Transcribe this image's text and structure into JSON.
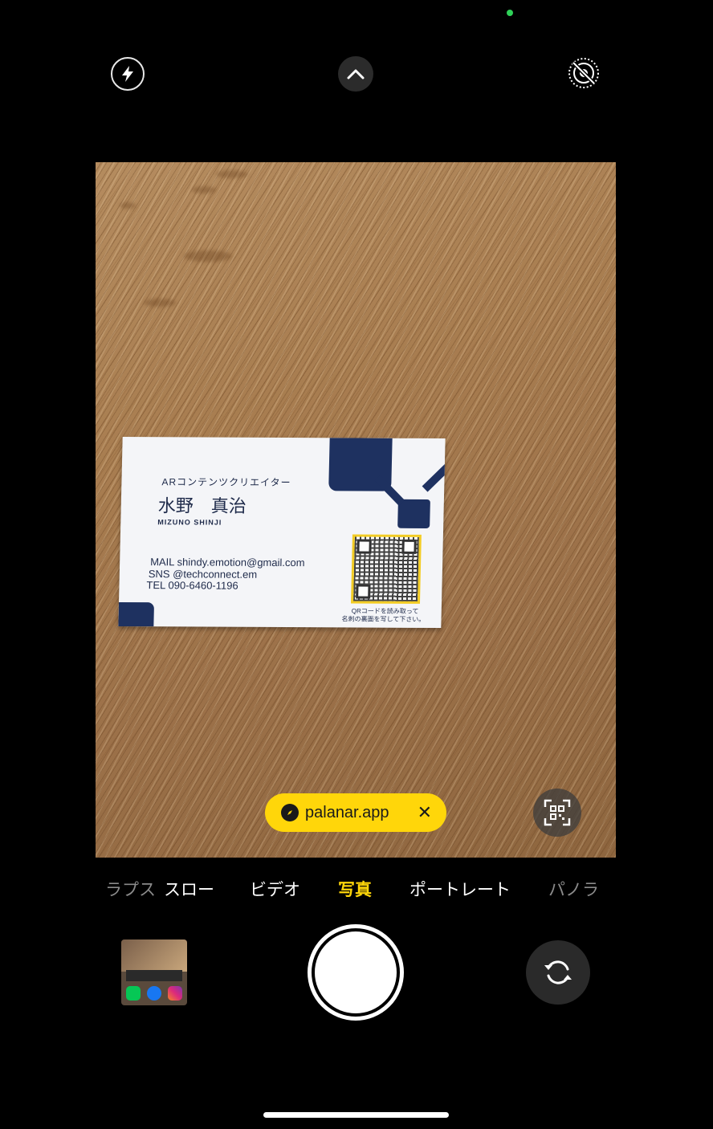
{
  "top_bar": {
    "flash_icon": "bolt-icon",
    "chevron_icon": "chevron-up-icon",
    "live_icon": "live-photo-off-icon"
  },
  "card": {
    "role": "ARコンテンツクリエイター",
    "name_jp": "水野　真治",
    "name_en": "MIZUNO SHINJI",
    "mail": "MAIL shindy.emotion@gmail.com",
    "sns": "SNS  @techconnect.em",
    "tel": "TEL   090-6460-1196",
    "qr_note_1": "QRコードを読み取って",
    "qr_note_2": "名刺の裏面を写して下さい。"
  },
  "qr_suggestion": {
    "url": "palanar.app",
    "close": "✕"
  },
  "modes": [
    "ラプス",
    "スロー",
    "ビデオ",
    "写真",
    "ポートレート",
    "パノラマ"
  ],
  "active_mode": "写真",
  "colors": {
    "accent": "#ffd60a",
    "card_navy": "#1e3160",
    "status_dot": "#2fd158"
  }
}
